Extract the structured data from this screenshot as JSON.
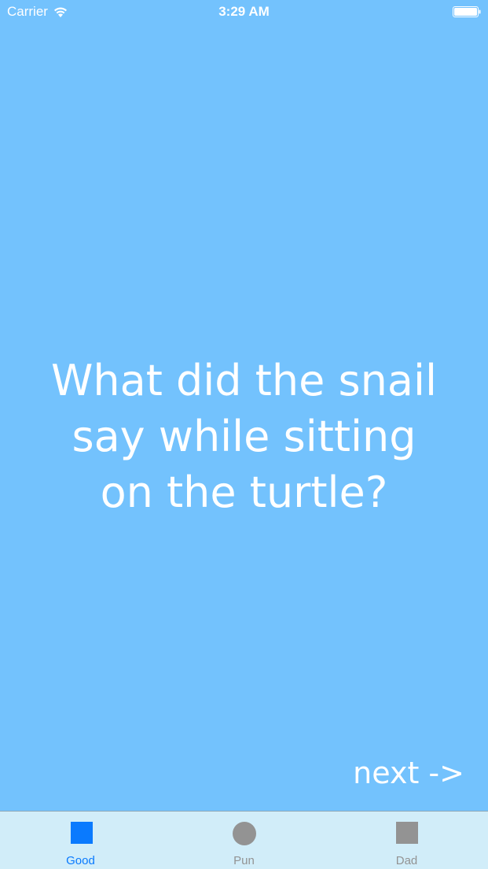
{
  "status_bar": {
    "carrier": "Carrier",
    "time": "3:29 AM",
    "wifi_icon": "wifi-icon",
    "battery_icon": "battery-icon"
  },
  "joke": {
    "line1": "What did the snail",
    "line2": "say while sitting",
    "line3": "on the turtle?"
  },
  "next_button": {
    "label": "next ->"
  },
  "tab_bar": {
    "tabs": [
      {
        "label": "Good",
        "icon": "square-icon",
        "selected": true
      },
      {
        "label": "Pun",
        "icon": "circle-icon",
        "selected": false
      },
      {
        "label": "Dad",
        "icon": "square-icon",
        "selected": false
      }
    ]
  },
  "colors": {
    "background": "#73c2fd",
    "tab_bar_background": "#d1edf9",
    "selected_tint": "#0a7afe",
    "unselected_tint": "#939393",
    "text": "#ffffff"
  }
}
